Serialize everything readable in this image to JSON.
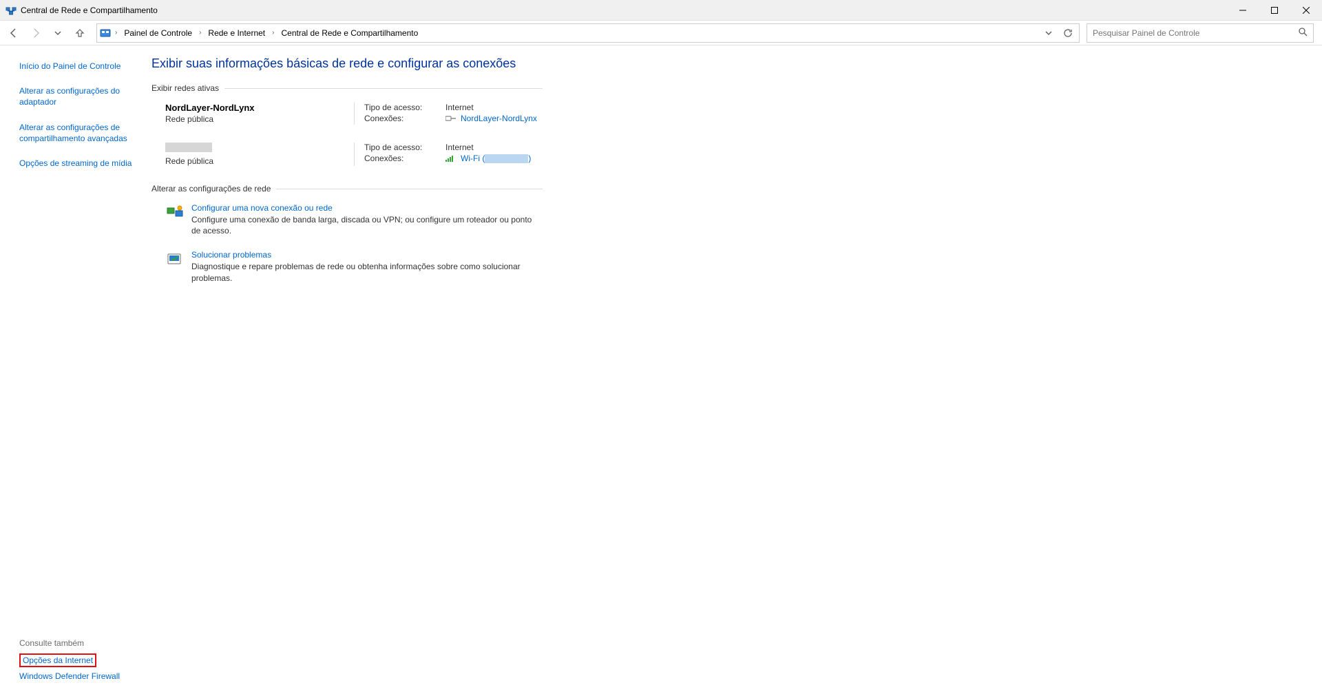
{
  "titlebar": {
    "title": "Central de Rede e Compartilhamento"
  },
  "breadcrumb": {
    "root": "Painel de Controle",
    "mid": "Rede e Internet",
    "leaf": "Central de Rede e Compartilhamento"
  },
  "search": {
    "placeholder": "Pesquisar Painel de Controle"
  },
  "sidebar": {
    "home": "Início do Painel de Controle",
    "adapter": "Alterar as configurações do adaptador",
    "sharing": "Alterar as configurações de compartilhamento avançadas",
    "streaming": "Opções de streaming de mídia"
  },
  "see_also": {
    "title": "Consulte também",
    "internet_options": "Opções da Internet",
    "firewall": "Windows Defender Firewall"
  },
  "main": {
    "heading": "Exibir suas informações básicas de rede e configurar as conexões",
    "view_active": "Exibir redes ativas",
    "change_settings": "Alterar as configurações de rede"
  },
  "labels": {
    "access_type": "Tipo de acesso:",
    "connections": "Conexões:"
  },
  "networks": [
    {
      "name": "NordLayer-NordLynx",
      "type": "Rede pública",
      "access": "Internet",
      "conn_link": "NordLayer-NordLynx",
      "blurred_name": false
    },
    {
      "name": "",
      "type": "Rede pública",
      "access": "Internet",
      "conn_link": "Wi-Fi (",
      "conn_link_close": ")",
      "blurred_name": true
    }
  ],
  "actions": {
    "setup": {
      "title": "Configurar uma nova conexão ou rede",
      "desc": "Configure uma conexão de banda larga, discada ou VPN; ou configure um roteador ou ponto de acesso."
    },
    "troubleshoot": {
      "title": "Solucionar problemas",
      "desc": "Diagnostique e repare problemas de rede ou obtenha informações sobre como solucionar problemas."
    }
  }
}
